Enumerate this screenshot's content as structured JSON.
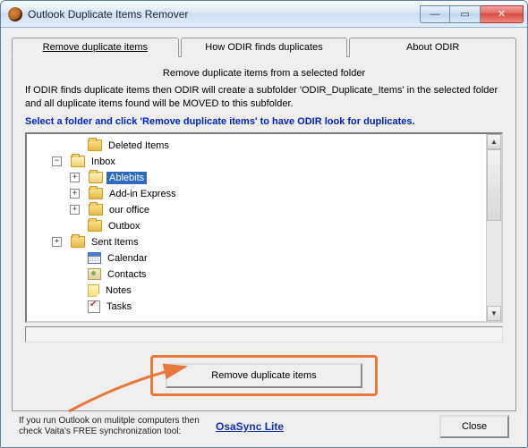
{
  "window": {
    "title": "Outlook Duplicate Items Remover"
  },
  "tabs": {
    "remove": "Remove duplicate items",
    "how": "How ODIR finds duplicates",
    "about": "About ODIR"
  },
  "body": {
    "heading": "Remove duplicate items from a selected folder",
    "desc": "If ODIR finds duplicate items then ODIR will create a subfolder 'ODIR_Duplicate_Items' in the selected folder and all duplicate items found will be MOVED to this subfolder.",
    "instruction": "Select a folder and click 'Remove duplicate items' to have ODIR look for duplicates."
  },
  "tree": {
    "deleted": "Deleted Items",
    "inbox": "Inbox",
    "ablebits": "Ablebits",
    "addin": "Add-in Express",
    "office": "our office",
    "outbox": "Outbox",
    "sent": "Sent Items",
    "calendar": "Calendar",
    "contacts": "Contacts",
    "notes": "Notes",
    "tasks": "Tasks"
  },
  "buttons": {
    "remove": "Remove duplicate items",
    "close": "Close"
  },
  "footer": {
    "note": "If you run Outlook on mulitple computers then check Vaita's FREE synchronization tool:",
    "link": "OsaSync Lite"
  }
}
